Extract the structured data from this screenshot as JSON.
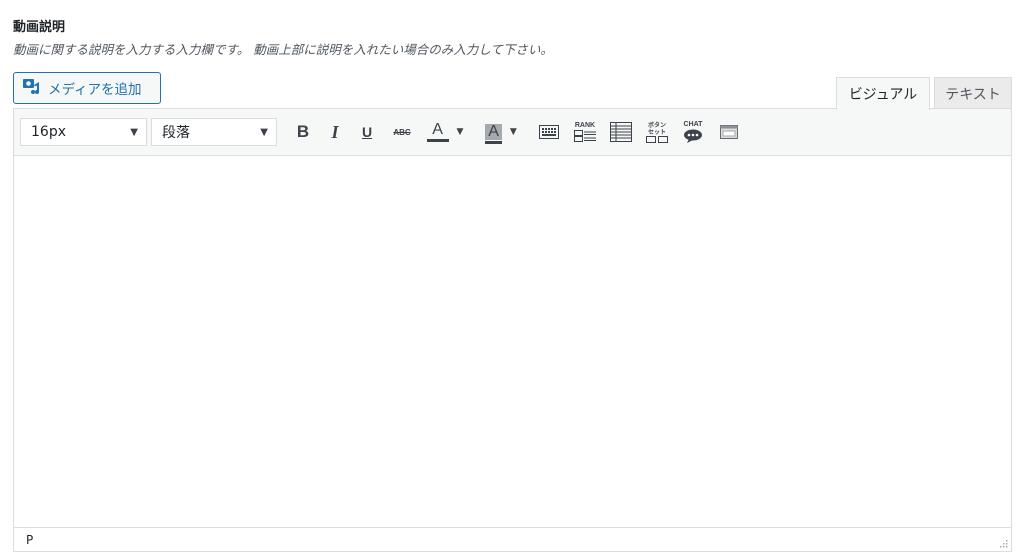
{
  "field": {
    "title": "動画説明",
    "description": "動画に関する説明を入力する入力欄です。 動画上部に説明を入れたい場合のみ入力して下さい。"
  },
  "media_button": {
    "label": "メディアを追加",
    "icon": "add-media-icon"
  },
  "tabs": [
    {
      "label": "ビジュアル",
      "active": true
    },
    {
      "label": "テキスト",
      "active": false
    }
  ],
  "toolbar": {
    "font_size": {
      "value": "16px",
      "icon": "chevron-down-icon"
    },
    "format": {
      "value": "段落",
      "icon": "chevron-down-icon"
    },
    "bold": "B",
    "italic": "I",
    "underline": "U",
    "strikethrough": "ABC",
    "text_color": "A",
    "bg_color": "A",
    "rank_label": "RANK",
    "button_set_label_1": "ボタン",
    "button_set_label_2": "セット",
    "chat_label": "CHAT",
    "icons": [
      "bold-icon",
      "italic-icon",
      "underline-icon",
      "strikethrough-icon",
      "text-color-icon",
      "background-color-icon",
      "keyboard-icon",
      "rank-icon",
      "table-icon",
      "button-set-icon",
      "chat-icon",
      "window-icon"
    ]
  },
  "statusbar": {
    "path": "P"
  },
  "colors": {
    "accent": "#2271b1",
    "border": "#dcdcde",
    "toolbar_bg": "#f6f7f7"
  }
}
